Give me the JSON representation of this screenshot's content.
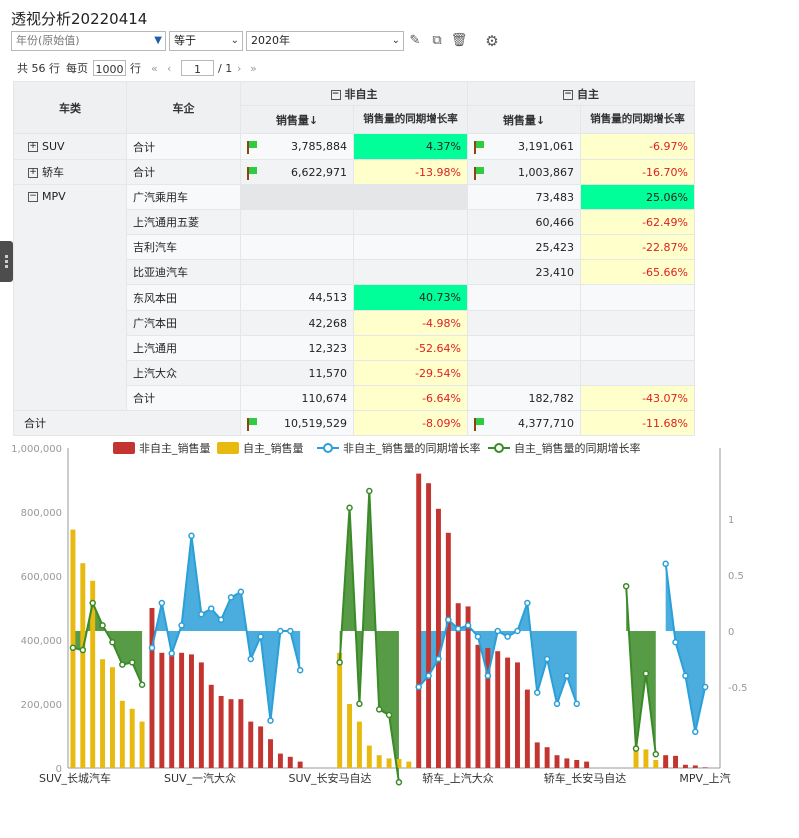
{
  "title": "透视分析20220414",
  "filter": {
    "field_placeholder": "年份(原始值)",
    "operator": "等于",
    "value": "2020年"
  },
  "pager": {
    "total": "共 56 行",
    "per_page_label": "每页",
    "per_page": "1000",
    "row_unit": "行",
    "page": "1",
    "page_total": "/ 1"
  },
  "table": {
    "headers": {
      "category": "车类",
      "company": "车企",
      "group_non_own": "非自主",
      "group_own": "自主",
      "sales": "销售量",
      "growth": "销售量的同期增长率"
    },
    "rows": [
      {
        "category": "SUV",
        "company": "合计",
        "ns": "3,785,884",
        "ng": "4.37%",
        "os": "3,191,061",
        "og": "-6.97%"
      },
      {
        "category": "轿车",
        "company": "合计",
        "ns": "6,622,971",
        "ng": "-13.98%",
        "os": "1,003,867",
        "og": "-16.70%"
      },
      {
        "category": "MPV",
        "company": "广汽乘用车",
        "ns": "",
        "ng": "",
        "os": "73,483",
        "og": "25.06%"
      },
      {
        "category": "",
        "company": "上汽通用五菱",
        "ns": "",
        "ng": "",
        "os": "60,466",
        "og": "-62.49%"
      },
      {
        "category": "",
        "company": "吉利汽车",
        "ns": "",
        "ng": "",
        "os": "25,423",
        "og": "-22.87%"
      },
      {
        "category": "",
        "company": "比亚迪汽车",
        "ns": "",
        "ng": "",
        "os": "23,410",
        "og": "-65.66%"
      },
      {
        "category": "",
        "company": "东风本田",
        "ns": "44,513",
        "ng": "40.73%",
        "os": "",
        "og": ""
      },
      {
        "category": "",
        "company": "广汽本田",
        "ns": "42,268",
        "ng": "-4.98%",
        "os": "",
        "og": ""
      },
      {
        "category": "",
        "company": "上汽通用",
        "ns": "12,323",
        "ng": "-52.64%",
        "os": "",
        "og": ""
      },
      {
        "category": "",
        "company": "上汽大众",
        "ns": "11,570",
        "ng": "-29.54%",
        "os": "",
        "og": ""
      },
      {
        "category": "",
        "company": "合计",
        "ns": "110,674",
        "ng": "-6.64%",
        "os": "182,782",
        "og": "-43.07%"
      }
    ],
    "total": {
      "label": "合计",
      "ns": "10,519,529",
      "ng": "-8.09%",
      "os": "4,377,710",
      "og": "-11.68%"
    }
  },
  "chart_data": {
    "type": "bar",
    "legend": [
      "非自主_销售量",
      "自主_销售量",
      "非自主_销售量的同期增长率",
      "自主_销售量的同期增长率"
    ],
    "colors": {
      "non_own_bar": "#c23531",
      "own_bar": "#e8b90f",
      "non_own_line": "#2a9fd8",
      "own_line": "#3a8a27"
    },
    "y_ticks": [
      "0",
      "200,000",
      "400,000",
      "600,000",
      "800,000",
      "1,000,000"
    ],
    "y_right_ticks": [
      "1",
      "0.5",
      "0",
      "-0.5"
    ],
    "x_labels": [
      "SUV_长城汽车",
      "SUV_一汽大众",
      "SUV_长安马自达",
      "轿车_上汽大众",
      "轿车_长安马自达",
      "MPV_上汽"
    ],
    "ylim": [
      0,
      1000000
    ],
    "own_sales": [
      745000,
      640000,
      585000,
      340000,
      315000,
      210000,
      185000,
      145000,
      0,
      0,
      0,
      0,
      0,
      0,
      0,
      0,
      0,
      0,
      0,
      0,
      0,
      0,
      0,
      0,
      0,
      0,
      0,
      360000,
      200000,
      145000,
      70000,
      40000,
      30000,
      28000,
      20000,
      0,
      0,
      0,
      0,
      0,
      0,
      0,
      0,
      0,
      0,
      0,
      0,
      0,
      0,
      0,
      0,
      0,
      0,
      0,
      0,
      0,
      0,
      70000,
      58000,
      25000,
      20000,
      0,
      0,
      0,
      0,
      0
    ],
    "non_own_sales": [
      0,
      0,
      0,
      0,
      0,
      0,
      0,
      0,
      500000,
      360000,
      360000,
      360000,
      355000,
      330000,
      260000,
      225000,
      215000,
      215000,
      145000,
      130000,
      90000,
      45000,
      35000,
      20000,
      0,
      0,
      0,
      0,
      0,
      0,
      0,
      0,
      0,
      0,
      0,
      920000,
      890000,
      810000,
      735000,
      515000,
      505000,
      385000,
      375000,
      365000,
      345000,
      330000,
      245000,
      80000,
      65000,
      40000,
      30000,
      25000,
      20000,
      0,
      0,
      0,
      0,
      0,
      0,
      0,
      40000,
      38000,
      10000,
      8000,
      2000
    ],
    "non_own_growth": [
      null,
      null,
      null,
      null,
      null,
      null,
      null,
      null,
      -0.15,
      0.25,
      -0.2,
      0.05,
      0.85,
      0.15,
      0.2,
      0.1,
      0.3,
      0.35,
      -0.25,
      -0.05,
      -0.8,
      0.0,
      0.0,
      -0.35,
      null,
      null,
      null,
      null,
      null,
      null,
      null,
      null,
      null,
      null,
      null,
      -0.5,
      -0.4,
      -0.25,
      0.1,
      0.02,
      0.05,
      -0.05,
      -0.4,
      0.0,
      -0.05,
      0.0,
      0.25,
      -0.55,
      -0.25,
      -0.65,
      -0.4,
      -0.65,
      null,
      null,
      null,
      null,
      null,
      null,
      null,
      null,
      0.6,
      -0.1,
      -0.4,
      -0.9,
      -0.5
    ],
    "own_growth": [
      -0.15,
      -0.17,
      0.25,
      0.05,
      -0.1,
      -0.3,
      -0.28,
      -0.48,
      null,
      null,
      null,
      null,
      null,
      null,
      null,
      null,
      null,
      null,
      null,
      null,
      null,
      null,
      null,
      null,
      null,
      null,
      null,
      -0.28,
      1.1,
      -0.65,
      1.25,
      -0.7,
      -0.75,
      -1.35,
      null,
      null,
      null,
      null,
      null,
      null,
      null,
      null,
      null,
      null,
      null,
      null,
      null,
      null,
      null,
      null,
      null,
      null,
      null,
      null,
      null,
      null,
      0.4,
      -1.05,
      -0.38,
      -1.1,
      null,
      null,
      null,
      null,
      null
    ]
  }
}
